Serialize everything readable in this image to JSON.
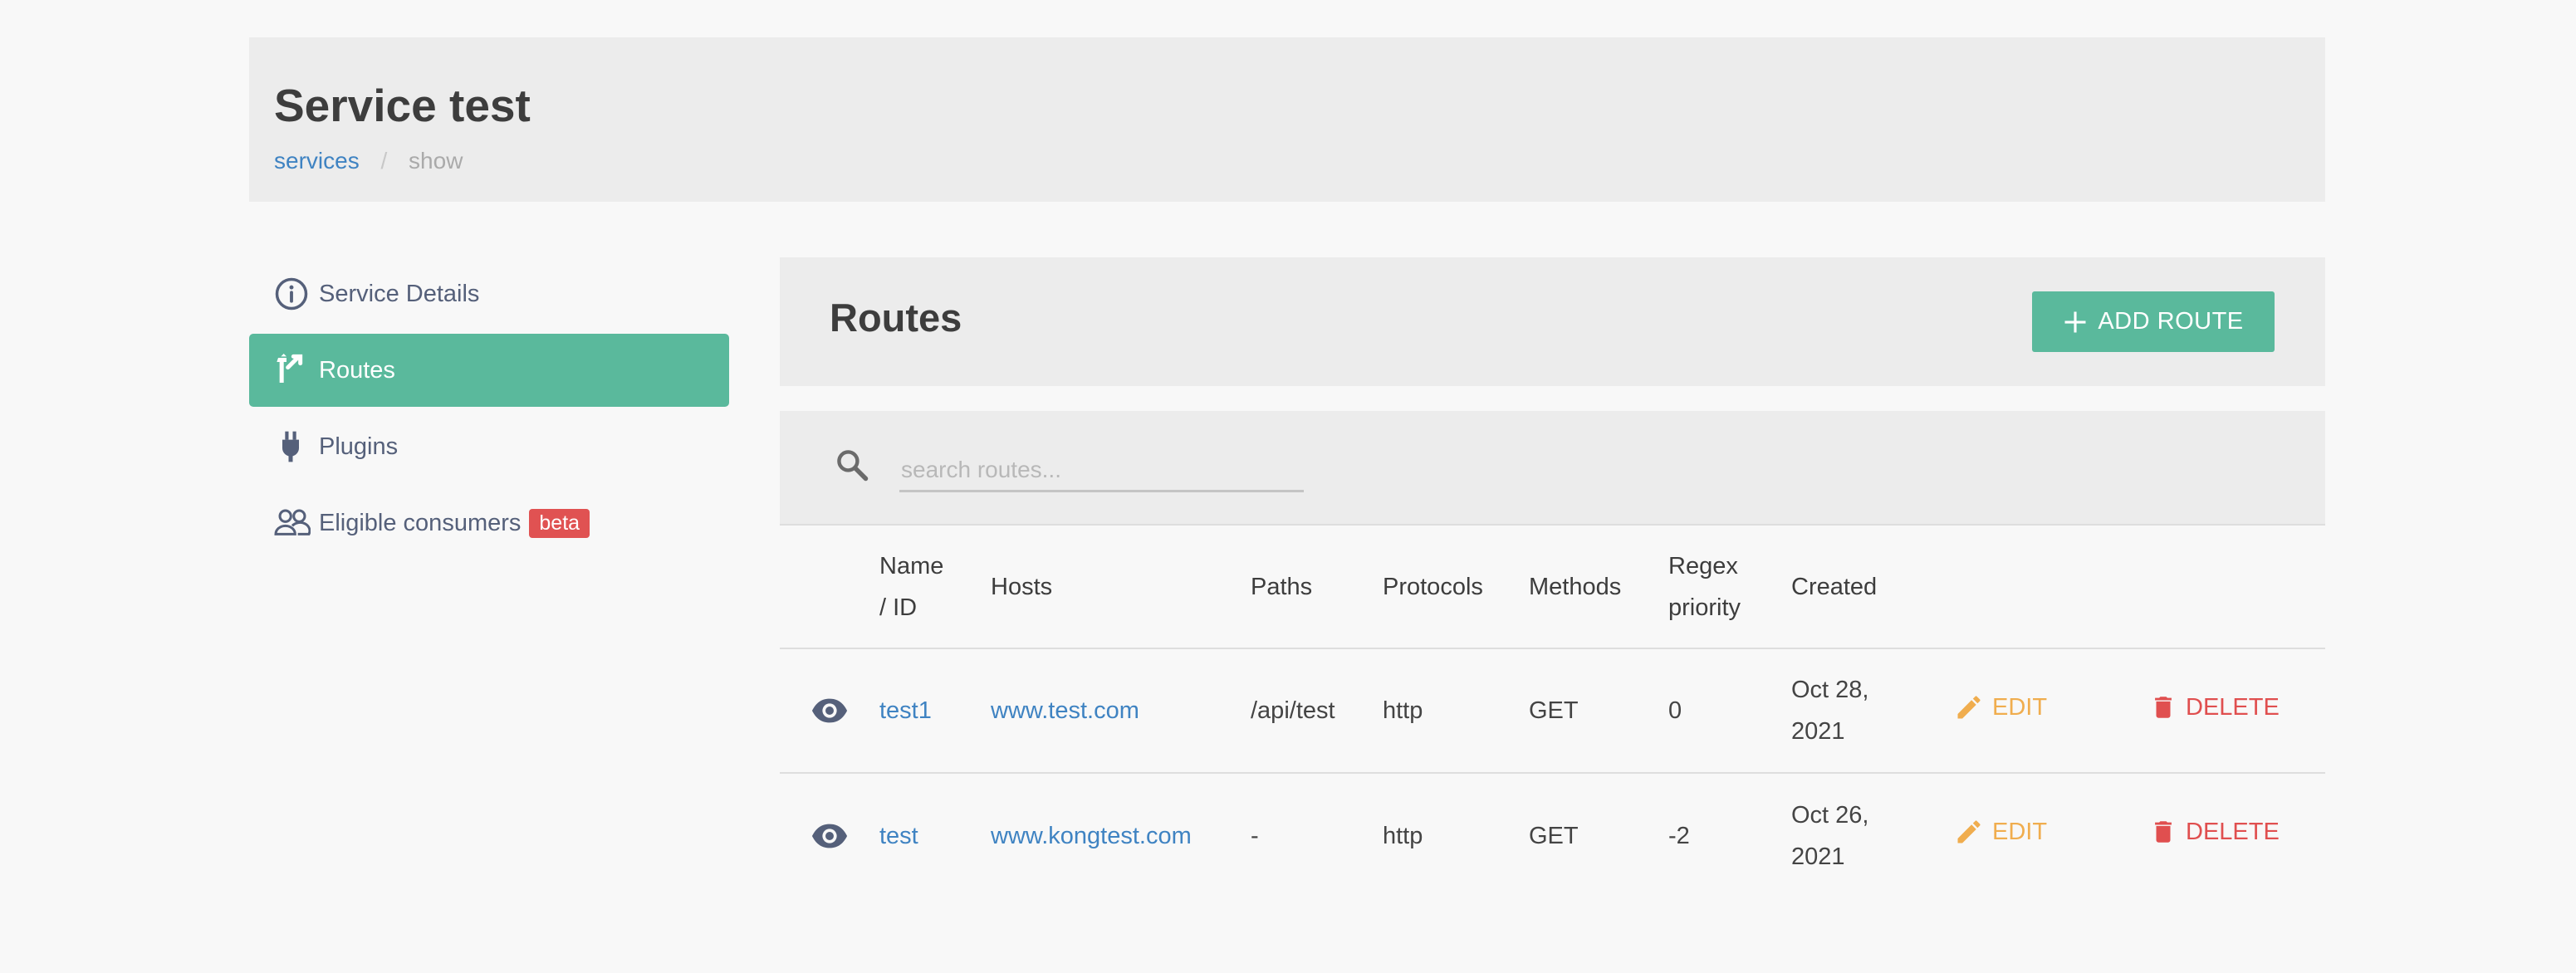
{
  "header": {
    "title": "Service test",
    "breadcrumb": {
      "link": "services",
      "current": "show"
    }
  },
  "sidebar": {
    "items": [
      {
        "label": "Service Details",
        "icon": "info-circle-icon"
      },
      {
        "label": "Routes",
        "icon": "routes-icon",
        "active": true
      },
      {
        "label": "Plugins",
        "icon": "plug-icon"
      },
      {
        "label": "Eligible consumers",
        "icon": "users-icon",
        "badge": "beta"
      }
    ]
  },
  "routes": {
    "title": "Routes",
    "add_label": "ADD ROUTE",
    "search_placeholder": "search routes...",
    "columns": [
      "Name / ID",
      "Hosts",
      "Paths",
      "Protocols",
      "Methods",
      "Regex priority",
      "Created"
    ],
    "rows": [
      {
        "name": "test1",
        "host": "www.test.com",
        "path": "/api/test",
        "protocol": "http",
        "method": "GET",
        "priority": "0",
        "created": "Oct 28, 2021",
        "edit": "EDIT",
        "delete": "DELETE"
      },
      {
        "name": "test",
        "host": "www.kongtest.com",
        "path": "-",
        "protocol": "http",
        "method": "GET",
        "priority": "-2",
        "created": "Oct 26, 2021",
        "edit": "EDIT",
        "delete": "DELETE"
      }
    ]
  },
  "colors": {
    "accent": "#5ab99c",
    "link": "#3f83c2",
    "edit": "#f0ad4e",
    "delete": "#e04f4f",
    "badge": "#e05252"
  }
}
